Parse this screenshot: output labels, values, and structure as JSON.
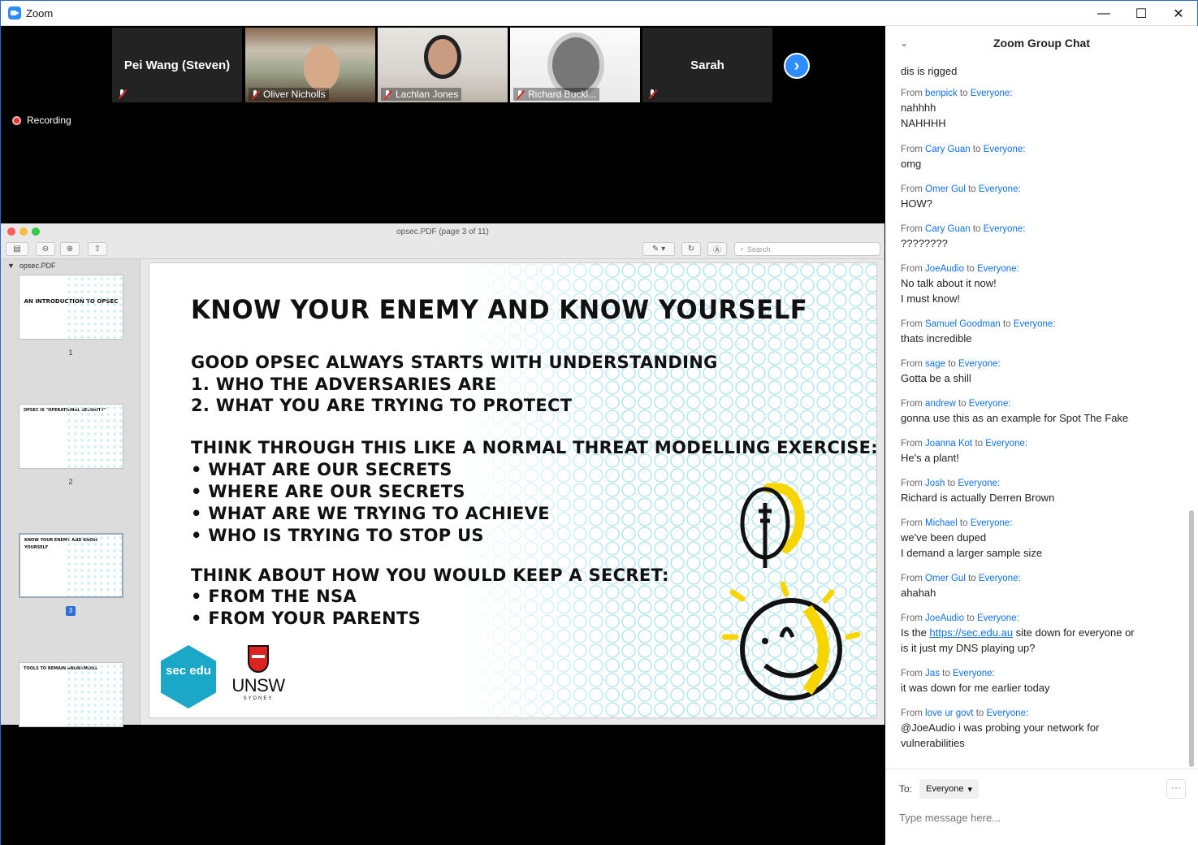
{
  "window": {
    "title": "Zoom",
    "minimize": "—",
    "maximize": "☐",
    "close": "✕"
  },
  "participants": [
    {
      "name": "Pei Wang (Steven)",
      "muted": true
    },
    {
      "name": "Oliver Nicholls",
      "muted": true
    },
    {
      "name": "Lachlan Jones",
      "muted": true
    },
    {
      "name": "Richard Buckl...",
      "muted": true
    },
    {
      "name": "Sarah",
      "muted": true
    }
  ],
  "next_glyph": "›",
  "recording": {
    "label": "Recording"
  },
  "preview": {
    "title": "opsec.PDF (page 3 of 11)",
    "search_placeholder": "Search",
    "sidebar_header": "opsec.PDF",
    "thumbs": [
      {
        "title": "AN INTRODUCTION TO OPSEC",
        "page": "1"
      },
      {
        "title": "OPSEC IS \"OPERATIONAL SECURITY\"",
        "page": "2"
      },
      {
        "title": "KNOW YOUR ENEMY AND KNOW YOURSELF",
        "page": "3"
      },
      {
        "title": "TOOLS TO REMAIN ANONYMOUS",
        "page": ""
      }
    ]
  },
  "slide": {
    "title": "KNOW YOUR ENEMY AND KNOW YOURSELF",
    "lines": [
      "GOOD OPSEC ALWAYS STARTS WITH UNDERSTANDING",
      "1.    WHO THE ADVERSARIES ARE",
      "2.    WHAT YOU ARE TRYING TO PROTECT",
      "THINK THROUGH THIS LIKE A NORMAL THREAT MODELLING EXERCISE:",
      "•    WHAT ARE OUR SECRETS",
      "•    WHERE ARE OUR SECRETS",
      "•    WHAT ARE WE TRYING TO ACHIEVE",
      "•    WHO IS TRYING TO STOP US",
      "THINK ABOUT HOW YOU WOULD KEEP A SECRET:",
      "•    FROM THE NSA",
      "•    FROM YOUR PARENTS"
    ],
    "logo_sec": "sec edu",
    "logo_unsw": "UNSW",
    "logo_unsw_sub": "SYDNEY"
  },
  "chat": {
    "title": "Zoom Group Chat",
    "messages": [
      {
        "from": "",
        "to": "",
        "lines": [
          "dis is rigged"
        ]
      },
      {
        "from": "benpick",
        "to": "Everyone:",
        "lines": [
          "nahhhh",
          "NAHHHH"
        ]
      },
      {
        "from": "Cary Guan",
        "to": "Everyone:",
        "lines": [
          "omg"
        ]
      },
      {
        "from": "Omer Gul",
        "to": "Everyone:",
        "lines": [
          "HOW?"
        ]
      },
      {
        "from": "Cary Guan",
        "to": "Everyone:",
        "lines": [
          "????????"
        ]
      },
      {
        "from": "JoeAudio",
        "to": "Everyone:",
        "lines": [
          "No talk about it now!",
          "I must know!"
        ]
      },
      {
        "from": "Samuel Goodman",
        "to": "Everyone:",
        "lines": [
          "thats incredible"
        ]
      },
      {
        "from": "sage",
        "to": "Everyone:",
        "lines": [
          "Gotta be a shill"
        ]
      },
      {
        "from": "andrew",
        "to": "Everyone:",
        "lines": [
          "gonna use this as an example for Spot The Fake"
        ]
      },
      {
        "from": "Joanna Kot",
        "to": "Everyone:",
        "lines": [
          "He's a plant!"
        ]
      },
      {
        "from": "Josh",
        "to": "Everyone:",
        "lines": [
          "Richard is actually Derren Brown"
        ]
      },
      {
        "from": "Michael",
        "to": "Everyone:",
        "lines": [
          "we've been duped",
          "I demand a larger sample size"
        ]
      },
      {
        "from": "Omer Gul",
        "to": "Everyone:",
        "lines": [
          "ahahah"
        ]
      },
      {
        "from": "JoeAudio",
        "to": "Everyone:",
        "lines": [
          "Is the https://sec.edu.au site down for everyone or",
          "is it just my DNS playing up?"
        ]
      },
      {
        "from": "Jas",
        "to": "Everyone:",
        "lines": [
          "it was down for me earlier today"
        ]
      },
      {
        "from": "love ur govt",
        "to": "Everyone:",
        "lines": [
          "@JoeAudio i was probing your network for",
          "vulnerabilities"
        ]
      }
    ],
    "from_word": "From",
    "to_word": "to",
    "compose": {
      "to_label": "To:",
      "recipient": "Everyone",
      "placeholder": "Type message here...",
      "more": "···"
    }
  }
}
